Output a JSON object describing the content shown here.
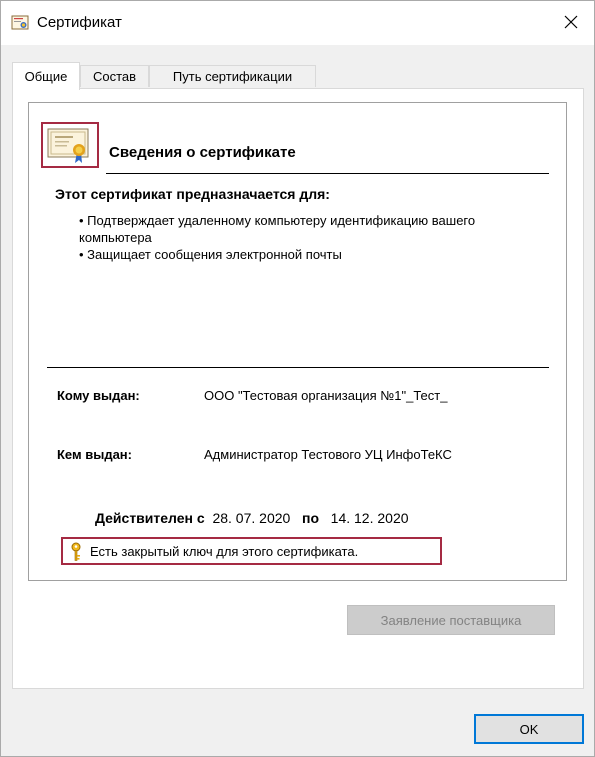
{
  "window": {
    "title": "Сертификат",
    "close_glyph": "✕"
  },
  "tabs": [
    {
      "label": "Общие",
      "active": true
    },
    {
      "label": "Состав",
      "active": false
    },
    {
      "label": "Путь сертификации",
      "active": false
    }
  ],
  "general": {
    "heading": "Сведения о сертификате",
    "purpose_title": "Этот сертификат предназначается для:",
    "purposes": [
      "• Подтверждает удаленному компьютеру идентификацию вашего компьютера",
      "• Защищает сообщения электронной почты"
    ],
    "issued_to_label": "Кому выдан:",
    "issued_to_value": "ООО \"Тестовая организация №1\"_Тест_",
    "issued_by_label": "Кем выдан:",
    "issued_by_value": "Администратор Тестового УЦ ИнфоТеКС",
    "valid_from_label": "Действителен с",
    "valid_from": "28. 07. 2020",
    "valid_to_label": "по",
    "valid_to": "14. 12. 2020",
    "private_key_note": "Есть закрытый ключ для этого сертификата."
  },
  "buttons": {
    "supplier_statement": "Заявление поставщика",
    "ok": "OK"
  },
  "icons": {
    "title": "certificate-icon",
    "cert_large": "certificate-icon",
    "key": "key-icon"
  },
  "colors": {
    "highlight_border": "#a52a43",
    "focus_border": "#0078d7"
  }
}
